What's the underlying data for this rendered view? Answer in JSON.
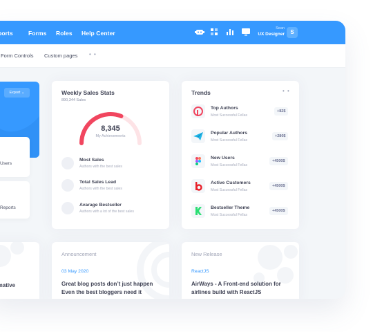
{
  "topnav": {
    "items": [
      "Reports",
      "Forms",
      "Roles",
      "Help Center"
    ],
    "user_name": "Sean",
    "user_role": "UX Designer",
    "avatar_letter": "S",
    "bg_color": "#3699ff"
  },
  "subnav": {
    "items": [
      "Form Controls",
      "Custom pages"
    ],
    "more": "• •"
  },
  "left": {
    "export_label": "Export",
    "users_label": "Users",
    "reports_label": "Reports",
    "bottom_text": "formative"
  },
  "weekly": {
    "title": "Weekly Sales Stats",
    "subtitle": "890,344 Sales",
    "gauge_value": "8,345",
    "gauge_label": "My Achievements",
    "gauge_fraction": 0.62,
    "items": [
      {
        "title": "Most Sales",
        "sub": "Authors with the best sales"
      },
      {
        "title": "Total Sales Lead",
        "sub": "Authors with the best sales"
      },
      {
        "title": "Avarage Bestseller",
        "sub": "Authors with a lot of the best sales"
      }
    ]
  },
  "trends": {
    "title": "Trends",
    "more": "• •",
    "items": [
      {
        "title": "Top Authors",
        "sub": "Most Successful Fellas",
        "badge": "+82$",
        "icon": "pinterest-icon"
      },
      {
        "title": "Popular Authors",
        "sub": "Most Successful Fellas",
        "badge": "+280$",
        "icon": "telegram-icon"
      },
      {
        "title": "New Users",
        "sub": "Most Successful Fellas",
        "badge": "+4500$",
        "icon": "figma-icon"
      },
      {
        "title": "Active Customers",
        "sub": "Most Successful Fellas",
        "badge": "+4500$",
        "icon": "bebo-icon"
      },
      {
        "title": "Bestseller Theme",
        "sub": "Most Successful Fellas",
        "badge": "+4500$",
        "icon": "kickstarter-icon"
      }
    ]
  },
  "announcement": {
    "title": "Announcement",
    "date": "03 May 2020",
    "line1": "Great blog posts don’t just happen",
    "line2": "Even the best bloggers need it"
  },
  "release": {
    "title": "New Release",
    "tag": "ReactJS",
    "line1": "AirWays - A Front-end solution for",
    "line2": "airlines build with ReactJS"
  }
}
